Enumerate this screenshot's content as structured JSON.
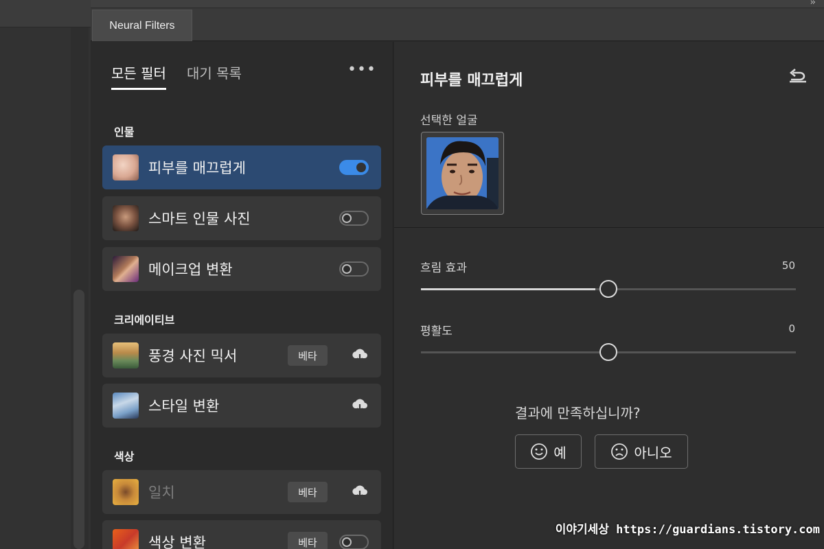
{
  "panel": {
    "tab_label": "Neural Filters"
  },
  "list": {
    "tabs": [
      {
        "label": "모든 필터"
      },
      {
        "label": "대기 목록"
      }
    ],
    "sections": [
      {
        "label": "인물"
      },
      {
        "label": "크리에이티브"
      },
      {
        "label": "색상"
      }
    ],
    "items": [
      {
        "label": "피부를 매끄럽게",
        "selected": true,
        "toggle": "on"
      },
      {
        "label": "스마트 인물 사진",
        "toggle": "off"
      },
      {
        "label": "메이크업 변환",
        "toggle": "off"
      },
      {
        "label": "풍경 사진 믹서",
        "badge": "베타",
        "download": true
      },
      {
        "label": "스타일 변환",
        "download": true
      },
      {
        "label": "일치",
        "badge": "베타",
        "download": true,
        "dimmed": true
      },
      {
        "label": "색상 변환",
        "badge": "베타",
        "toggle": "off"
      }
    ]
  },
  "settings": {
    "title": "피부를 매끄럽게",
    "selected_face_label": "선택한 얼굴",
    "sliders": [
      {
        "label": "흐림 효과",
        "value": "50",
        "position": 0.5
      },
      {
        "label": "평활도",
        "value": "0",
        "position": 0.5
      }
    ],
    "feedback": {
      "question": "결과에 만족하십니까?",
      "yes_label": "예",
      "no_label": "아니오"
    }
  },
  "watermark": "이야기세상 https://guardians.tistory.com",
  "colors": {
    "accent": "#3b8be8",
    "selected_row": "#2c4a72"
  }
}
